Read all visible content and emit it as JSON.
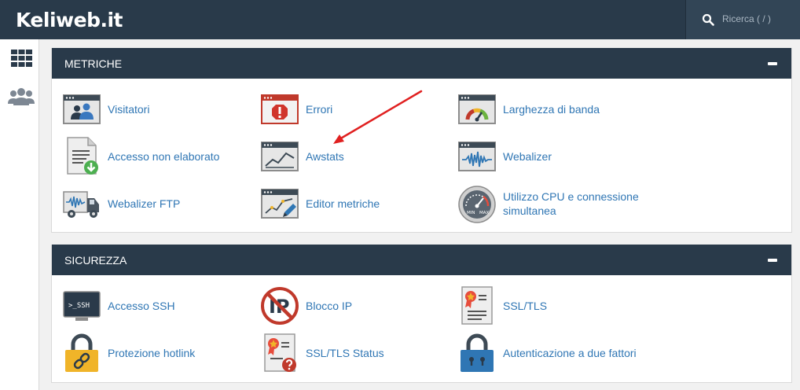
{
  "header": {
    "brand": "Keliweb.it",
    "search_placeholder": "Ricerca ( / )"
  },
  "sidebar": {
    "items": [
      {
        "icon": "grid-icon"
      },
      {
        "icon": "users-icon"
      }
    ]
  },
  "sections": [
    {
      "title": "METRICHE",
      "items": [
        {
          "label": "Visitatori",
          "icon": "visitors-icon"
        },
        {
          "label": "Errori",
          "icon": "errors-icon"
        },
        {
          "label": "Larghezza di banda",
          "icon": "bandwidth-icon"
        },
        {
          "label": "Accesso non elaborato",
          "icon": "raw-access-icon"
        },
        {
          "label": "Awstats",
          "icon": "awstats-icon"
        },
        {
          "label": "Webalizer",
          "icon": "webalizer-icon"
        },
        {
          "label": "Webalizer FTP",
          "icon": "webalizer-ftp-icon"
        },
        {
          "label": "Editor metriche",
          "icon": "metrics-editor-icon"
        },
        {
          "label": "Utilizzo CPU e connessione simultanea",
          "icon": "cpu-usage-icon"
        }
      ]
    },
    {
      "title": "SICUREZZA",
      "items": [
        {
          "label": "Accesso SSH",
          "icon": "ssh-icon"
        },
        {
          "label": "Blocco IP",
          "icon": "ip-block-icon"
        },
        {
          "label": "SSL/TLS",
          "icon": "ssl-certificate-icon"
        },
        {
          "label": "Protezione hotlink",
          "icon": "hotlink-lock-icon"
        },
        {
          "label": "SSL/TLS Status",
          "icon": "ssl-status-icon"
        },
        {
          "label": "Autenticazione a due fattori",
          "icon": "two-factor-lock-icon"
        }
      ]
    }
  ],
  "icon_text": {
    "ssh": ">_SSH",
    "ip": "IP",
    "cpu_min": "MIN",
    "cpu_max": "MAX"
  },
  "colors": {
    "header": "#293a4a",
    "link": "#2f76b4",
    "annotation_arrow": "#e02020"
  }
}
